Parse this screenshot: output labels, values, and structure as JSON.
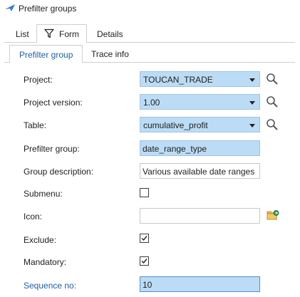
{
  "header": {
    "title": "Prefilter groups",
    "arrow_icon": "arrow-icon"
  },
  "tabs": [
    {
      "label": "List"
    },
    {
      "label": "Form",
      "icon": "funnel-icon"
    },
    {
      "label": "Details"
    }
  ],
  "subtabs": [
    {
      "label": "Prefilter group"
    },
    {
      "label": "Trace info"
    }
  ],
  "form": {
    "project": {
      "label": "Project:",
      "value": "TOUCAN_TRADE"
    },
    "project_version": {
      "label": "Project version:",
      "value": "1.00"
    },
    "table": {
      "label": "Table:",
      "value": "cumulative_profit"
    },
    "prefilter_group": {
      "label": "Prefilter group:",
      "value": "date_range_type"
    },
    "group_description": {
      "label": "Group description:",
      "value": "Various available date ranges"
    },
    "submenu": {
      "label": "Submenu:",
      "checked": false
    },
    "icon": {
      "label": "Icon:",
      "value": ""
    },
    "exclude": {
      "label": "Exclude:",
      "checked": true
    },
    "mandatory": {
      "label": "Mandatory:",
      "checked": true
    },
    "sequence_no": {
      "label": "Sequence no:",
      "value": "10"
    }
  },
  "colors": {
    "accent_blue": "#1e5ea8",
    "field_fill": "#bcdcf5",
    "focus_border": "#4a90d9"
  }
}
